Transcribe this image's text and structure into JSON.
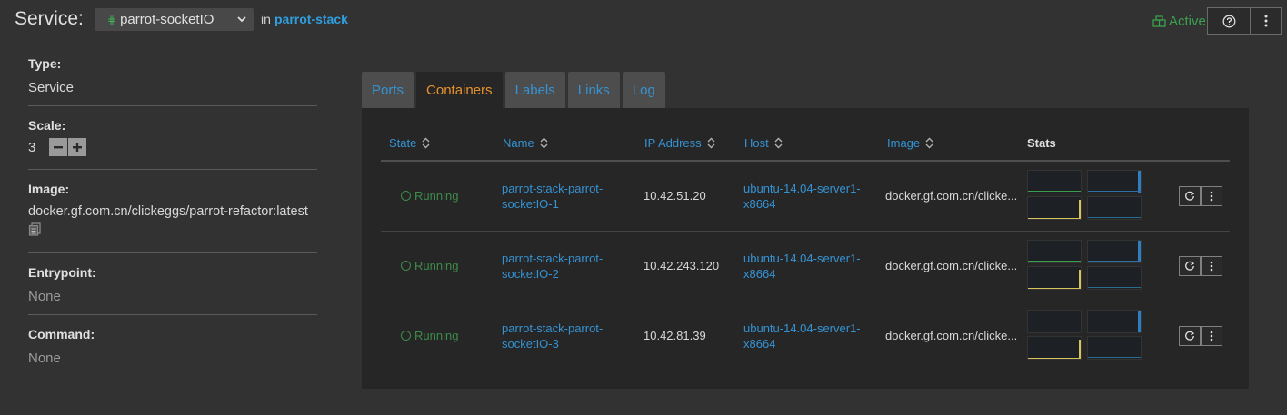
{
  "header": {
    "service_label": "Service:",
    "service_name": "parrot-socketIO",
    "in_text": "in",
    "stack_name": "parrot-stack",
    "status": "Active",
    "status_color": "#3aa04e",
    "accent_color": "#3593d3"
  },
  "info": {
    "type_label": "Type:",
    "type_value": "Service",
    "scale_label": "Scale:",
    "scale_value": "3",
    "image_label": "Image:",
    "image_value": "docker.gf.com.cn/clickeggs/parrot-refactor:latest",
    "entrypoint_label": "Entrypoint:",
    "entrypoint_value": "None",
    "command_label": "Command:",
    "command_value": "None"
  },
  "tabs": [
    {
      "label": "Ports",
      "active": false
    },
    {
      "label": "Containers",
      "active": true
    },
    {
      "label": "Labels",
      "active": false
    },
    {
      "label": "Links",
      "active": false
    },
    {
      "label": "Log",
      "active": false
    }
  ],
  "table": {
    "columns": [
      "State",
      "Name",
      "IP Address",
      "Host",
      "Image",
      "Stats"
    ],
    "rows": [
      {
        "state": "Running",
        "name_line1": "parrot-stack-parrot-",
        "name_line2": "socketIO-1",
        "ip": "10.42.51.20",
        "host_line1": "ubuntu-14.04-server1-",
        "host_line2": "x8664",
        "image": "docker.gf.com.cn/clicke..."
      },
      {
        "state": "Running",
        "name_line1": "parrot-stack-parrot-",
        "name_line2": "socketIO-2",
        "ip": "10.42.243.120",
        "host_line1": "ubuntu-14.04-server1-",
        "host_line2": "x8664",
        "image": "docker.gf.com.cn/clicke..."
      },
      {
        "state": "Running",
        "name_line1": "parrot-stack-parrot-",
        "name_line2": "socketIO-3",
        "ip": "10.42.81.39",
        "host_line1": "ubuntu-14.04-server1-",
        "host_line2": "x8664",
        "image": "docker.gf.com.cn/clicke..."
      }
    ]
  }
}
